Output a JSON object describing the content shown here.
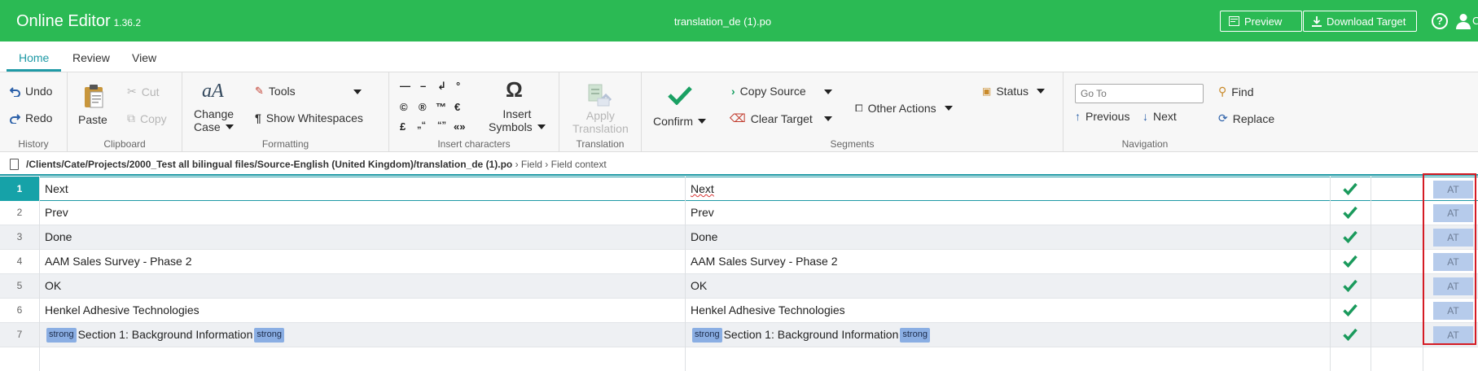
{
  "app": {
    "title": "Online Editor",
    "version": "1.36.2",
    "document": "translation_de (1).po",
    "preview_label": "Preview",
    "download_label": "Download Target",
    "help_symbol": "?",
    "user_letter": "C"
  },
  "tabs": [
    {
      "label": "Home",
      "active": true
    },
    {
      "label": "Review"
    },
    {
      "label": "View"
    }
  ],
  "ribbon": {
    "history": {
      "undo": "Undo",
      "redo": "Redo",
      "label": "History"
    },
    "clipboard": {
      "paste": "Paste",
      "cut": "Cut",
      "copy": "Copy",
      "label": "Clipboard"
    },
    "formatting": {
      "change_case_line1": "Change",
      "change_case_line2": "Case",
      "tools": "Tools",
      "show_whitespaces": "Show Whitespaces",
      "label": "Formatting"
    },
    "insert_characters": {
      "symbols": [
        "—",
        "–",
        "↲",
        "°",
        "©",
        "®",
        "™",
        "€",
        "£",
        "„“",
        "“”",
        "«»"
      ],
      "insert_symbols_line1": "Insert",
      "insert_symbols_line2": "Symbols",
      "label": "Insert characters"
    },
    "translation": {
      "apply_line1": "Apply",
      "apply_line2": "Translation",
      "label": "Translation"
    },
    "segments": {
      "confirm": "Confirm",
      "copy_source": "Copy Source",
      "clear_target": "Clear Target",
      "other_actions": "Other Actions",
      "status": "Status",
      "label": "Segments"
    },
    "navigation": {
      "goto_placeholder": "Go To",
      "previous": "Previous",
      "next": "Next",
      "find": "Find",
      "replace": "Replace",
      "label": "Navigation"
    }
  },
  "path": {
    "file": "/Clients/Cate/Projects/2000_Test all bilingual files/Source-English (United Kingdom)/translation_de (1).po",
    "crumbs": [
      "Field",
      "Field context"
    ]
  },
  "segments": [
    {
      "num": "1",
      "source": "Next",
      "target": "Next",
      "confirmed": true,
      "origin": "AT",
      "active": true
    },
    {
      "num": "2",
      "source": "Prev",
      "target": "Prev",
      "confirmed": true,
      "origin": "AT"
    },
    {
      "num": "3",
      "source": "Done",
      "target": "Done",
      "confirmed": true,
      "origin": "AT"
    },
    {
      "num": "4",
      "source": "AAM Sales Survey - Phase 2",
      "target": "AAM Sales Survey - Phase 2",
      "confirmed": true,
      "origin": "AT"
    },
    {
      "num": "5",
      "source": "OK",
      "target": "OK",
      "confirmed": true,
      "origin": "AT"
    },
    {
      "num": "6",
      "source": "Henkel Adhesive Technologies",
      "target": "Henkel Adhesive Technologies",
      "confirmed": true,
      "origin": "AT"
    },
    {
      "num": "7",
      "tag": "strong",
      "source": "Section 1:  Background Information",
      "target": "Section 1:  Background Information",
      "confirmed": true,
      "origin": "AT"
    }
  ],
  "colors": {
    "brand_green": "#2bba54",
    "accent_teal": "#1f9aa6",
    "tag_blue": "#8aaee3",
    "highlight_red": "#d51b24"
  }
}
